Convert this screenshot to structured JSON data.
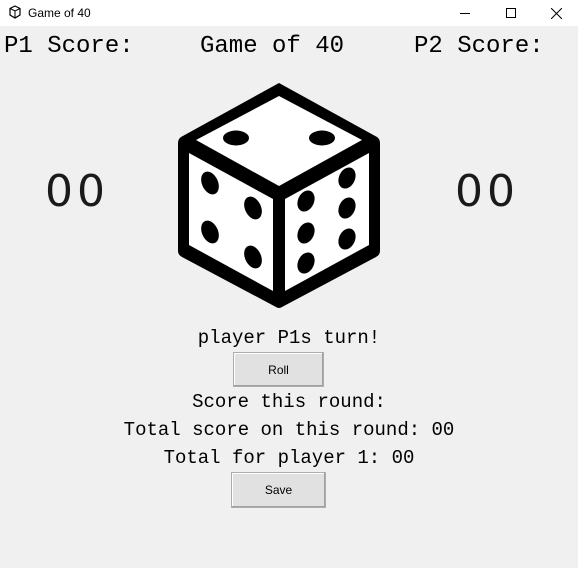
{
  "window": {
    "title": "Game of 40",
    "app_icon": "dice-icon",
    "controls": [
      "minimize-icon",
      "maximize-icon",
      "close-icon"
    ]
  },
  "header": {
    "p1_label": "P1 Score:",
    "game_title": "Game of 40",
    "p2_label": "P2 Score:"
  },
  "scores": {
    "p1": "00",
    "p2": "00"
  },
  "dice_icon": "dice-icon",
  "status": {
    "turn": "player P1s turn!",
    "score_this_round": "Score this round:",
    "total_score_round": "Total score on this round: 00",
    "total_player": "Total for player 1: 00"
  },
  "buttons": {
    "roll": "Roll",
    "save": "Save"
  }
}
